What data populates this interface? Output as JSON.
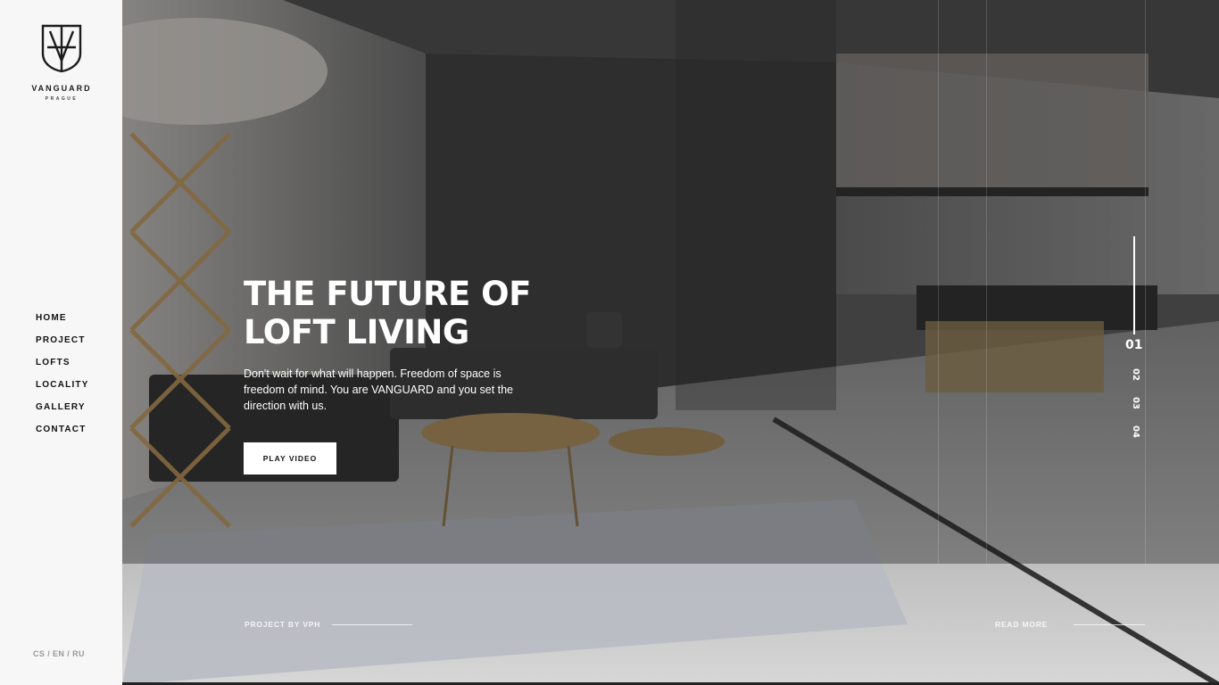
{
  "brand": {
    "name": "VANGUARD",
    "city": "PRAGUE"
  },
  "nav": {
    "items": [
      "HOME",
      "PROJECT",
      "LOFTS",
      "LOCALITY",
      "GALLERY",
      "CONTACT"
    ]
  },
  "languages": {
    "cs": "CS",
    "en": "EN",
    "ru": "RU",
    "separator": "/"
  },
  "hero": {
    "title_line1": "THE FUTURE OF",
    "title_line2": "LOFT LIVING",
    "text": "Don't wait for what will happen. Freedom of space is freedom of mind. You are VANGUARD and you set the direction with us.",
    "button_label": "PLAY VIDEO"
  },
  "slider": {
    "active": "01",
    "others": [
      "02",
      "03",
      "04"
    ]
  },
  "footer_links": {
    "project_label": "PROJECT BY VPH",
    "read_more": "READ MORE"
  },
  "colors": {
    "sidebar_bg": "#f7f7f7",
    "text_dark": "#111111",
    "hero_text": "#ffffff"
  }
}
